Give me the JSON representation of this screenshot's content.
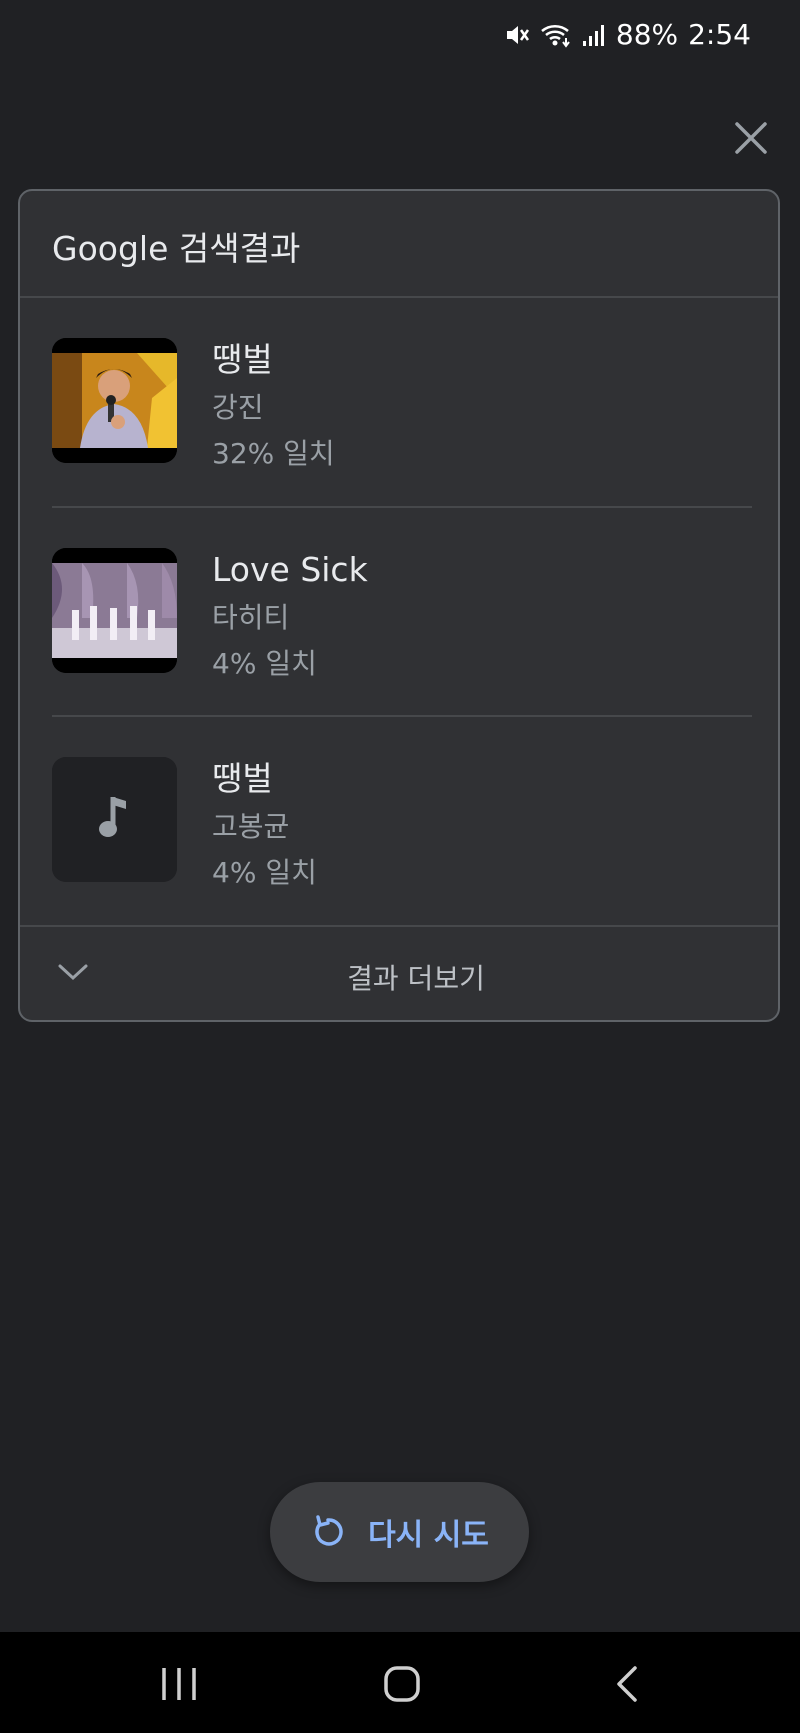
{
  "status_bar": {
    "battery": "88%",
    "time": "2:54",
    "icons": [
      "mute-icon",
      "wifi-icon",
      "signal-icon"
    ]
  },
  "card": {
    "title": "Google 검색결과",
    "results": [
      {
        "title": "땡벌",
        "artist": "강진",
        "match": "32% 일치",
        "thumb": "photo"
      },
      {
        "title": "Love Sick",
        "artist": "타히티",
        "match": "4% 일치",
        "thumb": "photo"
      },
      {
        "title": "땡벌",
        "artist": "고봉균",
        "match": "4% 일치",
        "thumb": "music-note-icon"
      }
    ],
    "more_label": "결과 더보기"
  },
  "retry": {
    "label": "다시 시도",
    "icon": "refresh-icon"
  },
  "nav": [
    "recent-apps-icon",
    "home-icon",
    "back-icon"
  ],
  "colors": {
    "background": "#202124",
    "card": "#303134",
    "accent": "#8ab4f8"
  }
}
